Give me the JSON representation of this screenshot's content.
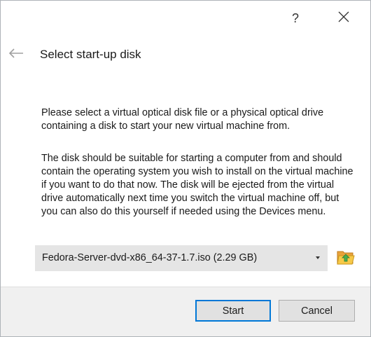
{
  "titlebar": {
    "help_glyph": "?",
    "close_glyph": "✕"
  },
  "page": {
    "heading": "Select start-up disk",
    "paragraph1": "Please select a virtual optical disk file or a physical optical drive containing a disk to start your new virtual machine from.",
    "paragraph2": "The disk should be suitable for starting a computer from and should contain the operating system you wish to install on the virtual machine if you want to do that now. The disk will be ejected from the virtual drive automatically next time you switch the virtual machine off, but you can also do this yourself if needed using the Devices menu."
  },
  "disk_select": {
    "selected": "Fedora-Server-dvd-x86_64-37-1.7.iso (2.29 GB)",
    "browse_icon": "folder-open-icon"
  },
  "buttons": {
    "start": "Start",
    "cancel": "Cancel"
  },
  "colors": {
    "default_button_border": "#0078d7",
    "footer_background": "#f0f0f0",
    "combo_background": "#e5e5e5"
  }
}
